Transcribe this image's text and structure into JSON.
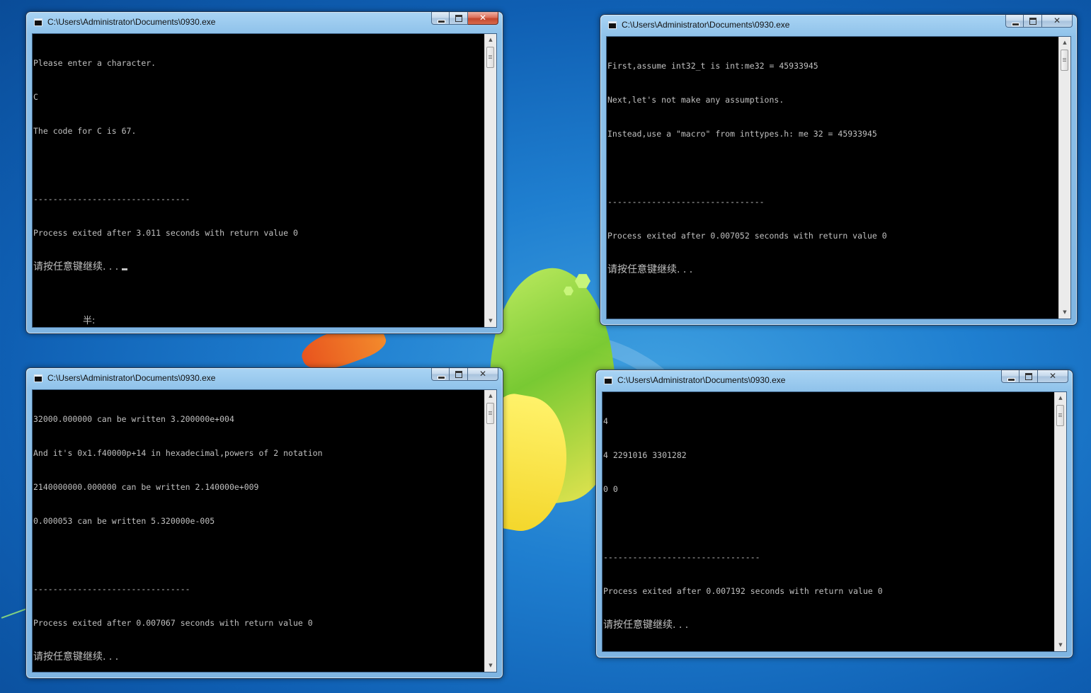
{
  "windows": [
    {
      "title": "C:\\Users\\Administrator\\Documents\\0930.exe",
      "active": true,
      "lines": [
        "Please enter a character.",
        "C",
        "The code for C is 67.",
        "",
        "--------------------------------",
        "Process exited after 3.011 seconds with return value 0",
        "请按任意键继续. . . "
      ],
      "ime_indicator": "半:"
    },
    {
      "title": "C:\\Users\\Administrator\\Documents\\0930.exe",
      "active": false,
      "lines": [
        "First,assume int32_t is int:me32 = 45933945",
        "Next,let's not make any assumptions.",
        "Instead,use a \"macro\" from inttypes.h: me 32 = 45933945",
        "",
        "--------------------------------",
        "Process exited after 0.007052 seconds with return value 0",
        "请按任意键继续. . ."
      ]
    },
    {
      "title": "C:\\Users\\Administrator\\Documents\\0930.exe",
      "active": false,
      "lines": [
        "32000.000000 can be written 3.200000e+004",
        "And it's 0x1.f40000p+14 in hexadecimal,powers of 2 notation",
        "2140000000.000000 can be written 2.140000e+009",
        "0.000053 can be written 5.320000e-005",
        "",
        "--------------------------------",
        "Process exited after 0.007067 seconds with return value 0",
        "请按任意键继续. . ."
      ]
    },
    {
      "title": "C:\\Users\\Administrator\\Documents\\0930.exe",
      "active": false,
      "lines": [
        "4",
        "4 2291016 3301282",
        "0 0",
        "",
        "--------------------------------",
        "Process exited after 0.007192 seconds with return value 0",
        "请按任意键继续. . ."
      ]
    }
  ],
  "controls": {
    "minimize_icon": "minimize-icon",
    "maximize_icon": "maximize-icon",
    "close_icon": "close-icon",
    "close_glyph": "✕"
  },
  "colors": {
    "console_bg": "#000000",
    "console_text": "#c0c0c0",
    "close_active": "#c4472d"
  }
}
